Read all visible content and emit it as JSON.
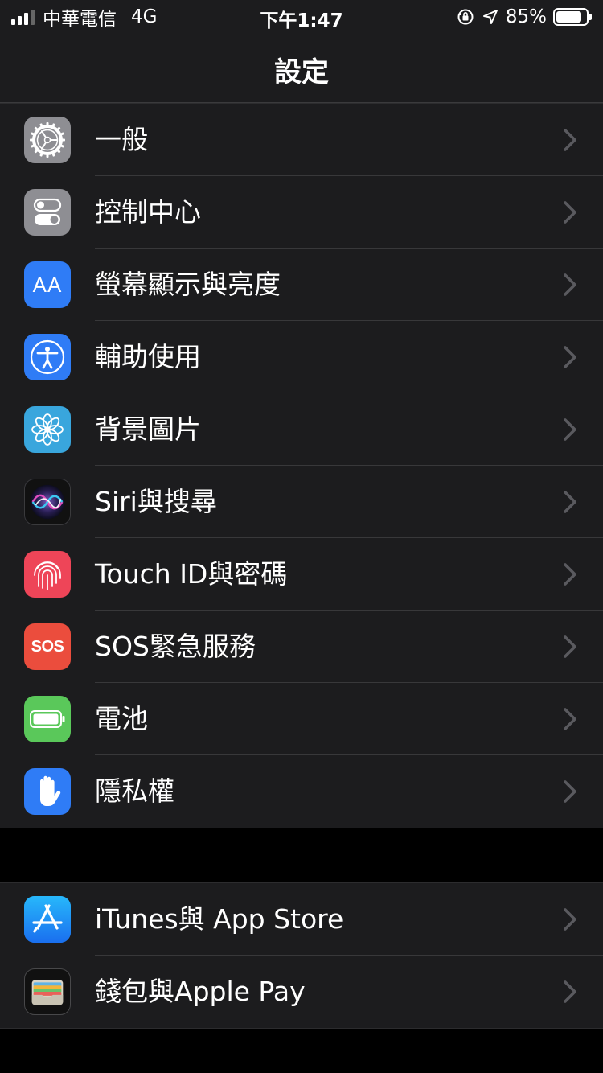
{
  "status_bar": {
    "carrier": "中華電信",
    "network": "4G",
    "time": "下午1:47",
    "battery_text": "85%",
    "battery_level": 0.85
  },
  "nav": {
    "title": "設定"
  },
  "groups": [
    {
      "items": [
        {
          "label": "一般",
          "icon": "gear-icon",
          "color": "#8e8e93"
        },
        {
          "label": "控制中心",
          "icon": "toggles-icon",
          "color": "#8e8e93"
        },
        {
          "label": "螢幕顯示與亮度",
          "icon": "text-size-icon",
          "color": "#2f7cf6"
        },
        {
          "label": "輔助使用",
          "icon": "accessibility-icon",
          "color": "#2f7cf6"
        },
        {
          "label": "背景圖片",
          "icon": "flower-icon",
          "color": "#39a6dd"
        },
        {
          "label": "Siri與搜尋",
          "icon": "siri-icon",
          "color": "#1b1b3a"
        },
        {
          "label": "Touch ID與密碼",
          "icon": "fingerprint-icon",
          "color": "#ee4558"
        },
        {
          "label": "SOS緊急服務",
          "icon": "sos-icon",
          "color": "#eb4d3d"
        },
        {
          "label": "電池",
          "icon": "battery-icon",
          "color": "#5ac85a"
        },
        {
          "label": "隱私權",
          "icon": "hand-icon",
          "color": "#2f7cf6"
        }
      ]
    },
    {
      "items": [
        {
          "label": "iTunes與 App Store",
          "icon": "app-store-icon",
          "color": "#1f8ef5"
        },
        {
          "label": "錢包與Apple Pay",
          "icon": "wallet-icon",
          "color": "#1c1c1e"
        }
      ]
    }
  ],
  "sos_icon_text": "SOS",
  "text_size_icon_text": "AA"
}
